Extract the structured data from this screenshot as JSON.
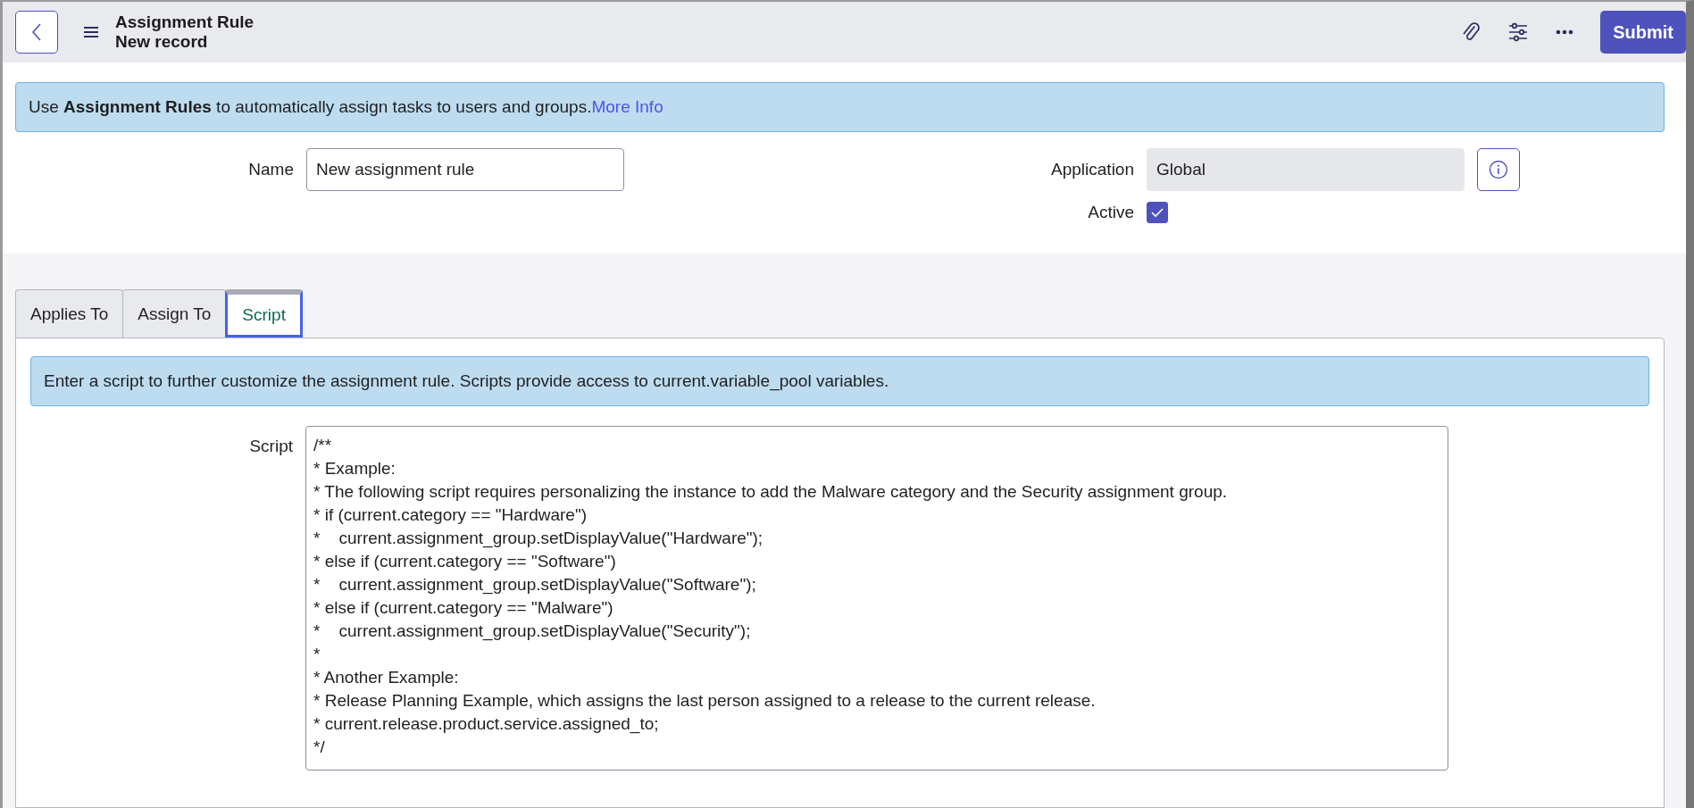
{
  "header": {
    "title": "Assignment Rule",
    "subtitle": "New record",
    "submit": "Submit"
  },
  "info_banner": {
    "text": "Use **Assignment Rules** to automatically assign tasks to users and groups.",
    "link": "More Info"
  },
  "fields": {
    "name": {
      "label": "Name",
      "value": "New assignment rule"
    },
    "application": {
      "label": "Application",
      "value": "Global"
    },
    "active": {
      "label": "Active",
      "checked": true
    }
  },
  "tabs": [
    {
      "label": "Applies To",
      "selected": false
    },
    {
      "label": "Assign To",
      "selected": false
    },
    {
      "label": "Script",
      "selected": true
    }
  ],
  "tab_panel": {
    "banner": "Enter a script to further customize the assignment rule. Scripts provide access to current.variable_pool variables.",
    "script_label": "Script",
    "script_value": "/**\n* Example:\n* The following script requires personalizing the instance to add the Malware category and the Security assignment group.\n* if (current.category == \"Hardware\")\n*    current.assignment_group.setDisplayValue(\"Hardware\");\n* else if (current.category == \"Software\")\n*    current.assignment_group.setDisplayValue(\"Software\");\n* else if (current.category == \"Malware\")\n*    current.assignment_group.setDisplayValue(\"Security\");\n*\n* Another Example:\n* Release Planning Example, which assigns the last person assigned to a release to the current release.\n* current.release.product.service.assigned_to;\n*/"
  }
}
